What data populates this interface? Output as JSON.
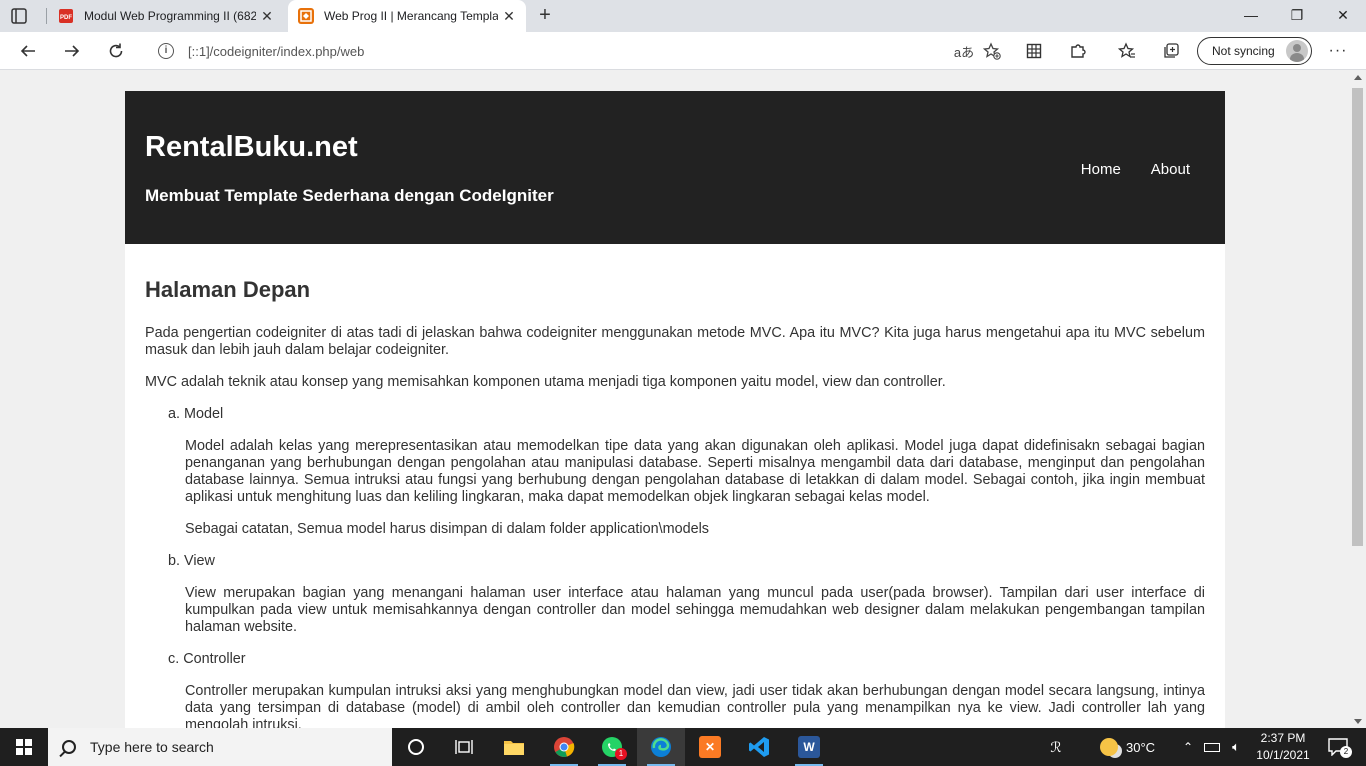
{
  "browser": {
    "tabs": [
      {
        "title": "Modul Web Programming II (682",
        "icon": "pdf-icon",
        "active": false
      },
      {
        "title": "Web Prog II | Merancang Templa",
        "icon": "codeigniter-icon",
        "active": true
      }
    ],
    "address": "[::1]/codeigniter/index.php/web",
    "sync_label": "Not syncing"
  },
  "site": {
    "title": "RentalBuku.net",
    "subtitle": "Membuat Template Sederhana dengan CodeIgniter",
    "nav": [
      "Home",
      "About"
    ],
    "heading": "Halaman Depan",
    "intro1": "Pada pengertian codeigniter di atas tadi di jelaskan bahwa codeigniter menggunakan metode MVC. Apa itu MVC? Kita juga harus mengetahui apa itu MVC sebelum masuk dan lebih jauh dalam belajar codeigniter.",
    "intro2": "MVC adalah teknik atau konsep yang memisahkan komponen utama menjadi tiga komponen yaitu model, view dan controller.",
    "items": [
      {
        "label": "a. Model",
        "body": "Model adalah kelas yang merepresentasikan atau memodelkan tipe data yang akan digunakan oleh aplikasi. Model juga dapat didefinisakn sebagai bagian penanganan yang berhubungan dengan pengolahan atau manipulasi database. Seperti misalnya mengambil data dari database, menginput dan pengolahan database lainnya. Semua intruksi atau fungsi yang berhubung dengan pengolahan database di letakkan di dalam model. Sebagai contoh, jika ingin membuat aplikasi untuk menghitung luas dan keliling lingkaran, maka dapat memodelkan objek lingkaran sebagai kelas model.",
        "note": "Sebagai catatan, Semua model harus disimpan di dalam folder application\\models"
      },
      {
        "label": "b. View",
        "body": "View merupakan bagian yang menangani halaman user interface atau halaman yang muncul pada user(pada browser). Tampilan dari user interface di kumpulkan pada view untuk memisahkannya dengan controller dan model sehingga memudahkan web designer dalam melakukan pengembangan tampilan halaman website."
      },
      {
        "label": "c. Controller",
        "body": "Controller merupakan kumpulan intruksi aksi yang menghubungkan model dan view, jadi user tidak akan berhubungan dengan model secara langsung, intinya data yang tersimpan di database (model) di ambil oleh controller dan kemudian controller pula yang menampilkan nya ke view. Jadi controller lah yang mengolah intruksi."
      }
    ]
  },
  "taskbar": {
    "search_placeholder": "Type here to search",
    "weather": "30°C",
    "time": "2:37 PM",
    "date": "10/1/2021",
    "whatsapp_badge": "1",
    "notification_count": "2"
  },
  "colors": {
    "header_bg": "#222222",
    "page_bg": "#f0f0f0",
    "taskbar_bg": "#1f1f1f"
  }
}
